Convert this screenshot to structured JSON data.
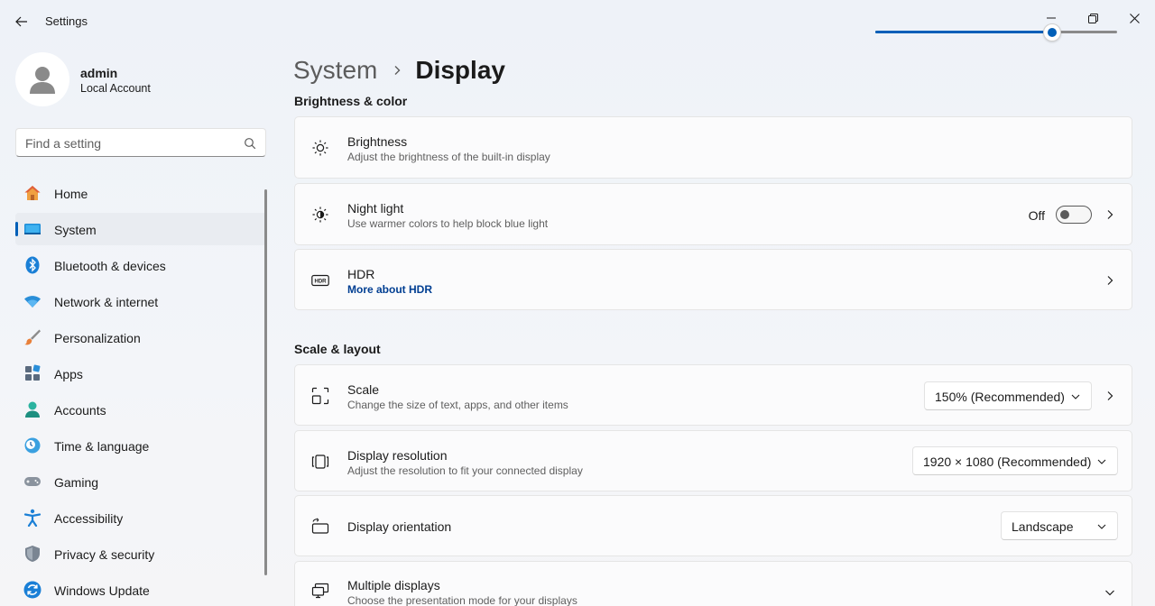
{
  "app": {
    "title": "Settings"
  },
  "user": {
    "name": "admin",
    "account_type": "Local Account"
  },
  "search": {
    "placeholder": "Find a setting"
  },
  "sidebar": {
    "items": [
      {
        "label": "Home",
        "icon": "home-icon"
      },
      {
        "label": "System",
        "icon": "system-icon",
        "active": true
      },
      {
        "label": "Bluetooth & devices",
        "icon": "bluetooth-icon"
      },
      {
        "label": "Network & internet",
        "icon": "wifi-icon"
      },
      {
        "label": "Personalization",
        "icon": "brush-icon"
      },
      {
        "label": "Apps",
        "icon": "apps-icon"
      },
      {
        "label": "Accounts",
        "icon": "accounts-icon"
      },
      {
        "label": "Time & language",
        "icon": "clock-globe-icon"
      },
      {
        "label": "Gaming",
        "icon": "gamepad-icon"
      },
      {
        "label": "Accessibility",
        "icon": "accessibility-icon"
      },
      {
        "label": "Privacy & security",
        "icon": "shield-icon"
      },
      {
        "label": "Windows Update",
        "icon": "update-icon"
      }
    ]
  },
  "breadcrumb": {
    "parent": "System",
    "current": "Display"
  },
  "sections": {
    "brightness_color": "Brightness & color",
    "scale_layout": "Scale & layout"
  },
  "cards": {
    "brightness": {
      "title": "Brightness",
      "subtitle": "Adjust the brightness of the built-in display",
      "value_fraction": 0.73
    },
    "night_light": {
      "title": "Night light",
      "subtitle": "Use warmer colors to help block blue light",
      "state_label": "Off",
      "enabled": false
    },
    "hdr": {
      "title": "HDR",
      "link": "More about HDR"
    },
    "scale": {
      "title": "Scale",
      "subtitle": "Change the size of text, apps, and other items",
      "value": "150% (Recommended)"
    },
    "resolution": {
      "title": "Display resolution",
      "subtitle": "Adjust the resolution to fit your connected display",
      "value": "1920 × 1080 (Recommended)"
    },
    "orientation": {
      "title": "Display orientation",
      "value": "Landscape"
    },
    "multiple": {
      "title": "Multiple displays",
      "subtitle": "Choose the presentation mode for your displays"
    }
  },
  "colors": {
    "accent": "#005fb8",
    "link": "#003e92"
  }
}
